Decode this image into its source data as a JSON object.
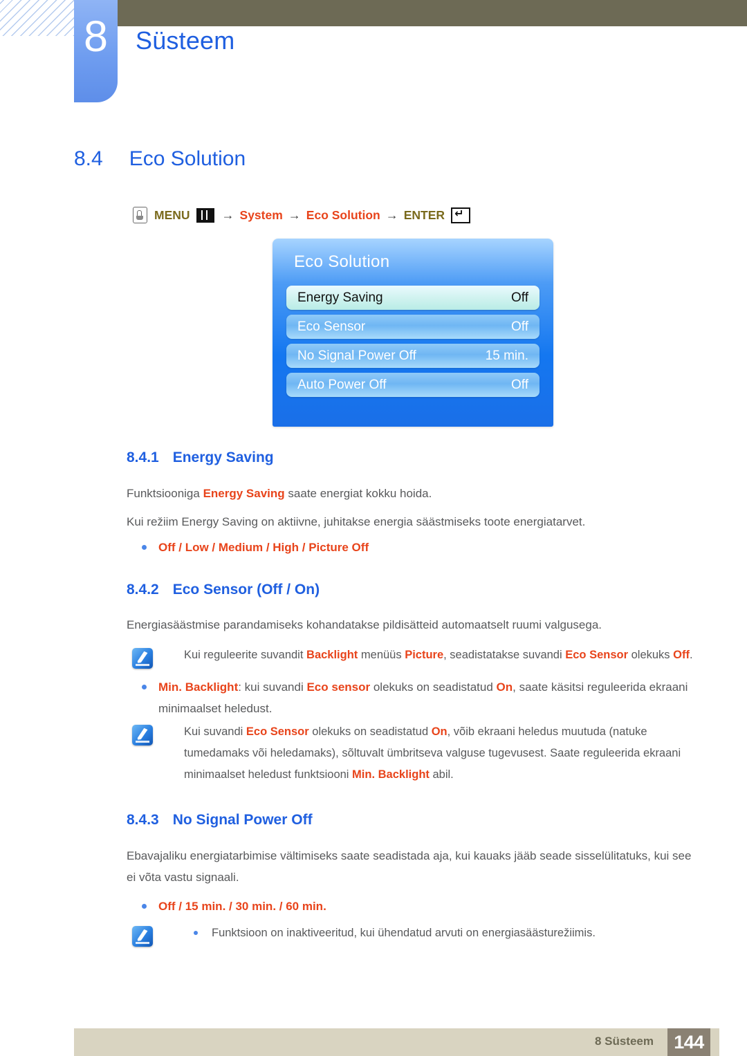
{
  "header": {
    "chapter_number": "8",
    "chapter_title": "Süsteem"
  },
  "section": {
    "number": "8.4",
    "title": "Eco Solution"
  },
  "nav_path": {
    "hand_icon": "hand-press-icon",
    "menu_label": "MENU",
    "menu_icon": "menu-bars-icon",
    "arrow1": "→",
    "step1": "System",
    "arrow2": "→",
    "step2": "Eco Solution",
    "arrow3": "→",
    "enter_label": "ENTER",
    "enter_icon": "enter-key-icon"
  },
  "osd": {
    "title": "Eco Solution",
    "rows": [
      {
        "label": "Energy Saving",
        "value": "Off",
        "selected": true
      },
      {
        "label": "Eco Sensor",
        "value": "Off",
        "selected": false
      },
      {
        "label": "No Signal Power Off",
        "value": "15 min.",
        "selected": false
      },
      {
        "label": "Auto Power Off",
        "value": "Off",
        "selected": false
      }
    ]
  },
  "sub1": {
    "number": "8.4.1",
    "title": "Energy Saving",
    "para1_a": "Funktsiooniga ",
    "para1_b": "Energy Saving",
    "para1_c": " saate energiat kokku hoida.",
    "para2": "Kui režiim Energy Saving on aktiivne, juhitakse energia säästmiseks toote energiatarvet.",
    "options": "Off / Low / Medium / High / Picture Off"
  },
  "sub2": {
    "number": "8.4.2",
    "title": "Eco Sensor (Off / On)",
    "para1": "Energiasäästmise parandamiseks kohandatakse pildisätteid automaatselt ruumi valgusega.",
    "note1_a": "Kui reguleerite suvandit ",
    "note1_b": "Backlight",
    "note1_c": " menüüs ",
    "note1_d": "Picture",
    "note1_e": ", seadistatakse suvandi ",
    "note1_f": "Eco Sensor",
    "note1_g": " olekuks ",
    "note1_h": "Off",
    "note1_i": ".",
    "bullet_a": "Min. Backlight",
    "bullet_b": ": kui suvandi ",
    "bullet_c": "Eco sensor",
    "bullet_d": " olekuks on seadistatud ",
    "bullet_e": "On",
    "bullet_f": ", saate käsitsi reguleerida ekraani minimaalset heledust.",
    "note2_a": "Kui suvandi ",
    "note2_b": "Eco Sensor",
    "note2_c": " olekuks on seadistatud ",
    "note2_d": "On",
    "note2_e": ", võib ekraani heledus muutuda (natuke tumedamaks või heledamaks), sõltuvalt ümbritseva valguse tugevusest. Saate reguleerida ekraani minimaalset heledust funktsiooni ",
    "note2_f": "Min. Backlight",
    "note2_g": " abil."
  },
  "sub3": {
    "number": "8.4.3",
    "title": "No Signal Power Off",
    "para1": "Ebavajaliku energiatarbimise vältimiseks saate seadistada aja, kui kauaks jääb seade sisselülitatuks, kui see ei võta vastu signaali.",
    "options": "Off / 15 min. / 30 min. / 60 min.",
    "note": "Funktsioon on inaktiveeritud, kui ühendatud arvuti on energiasäästurežiimis."
  },
  "footer": {
    "label": "8 Süsteem",
    "page": "144"
  },
  "colors": {
    "heading_blue": "#1f5fe0",
    "accent_orange": "#e8441b",
    "gold": "#7a6a1c",
    "olive_bar": "#6d6a55",
    "footer_bar": "#d9d4c1",
    "page_box": "#8a8173",
    "body_text": "#58595b"
  }
}
